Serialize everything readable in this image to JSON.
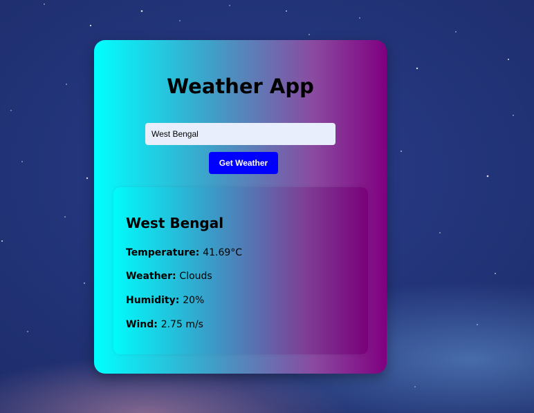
{
  "app": {
    "title": "Weather App"
  },
  "search": {
    "value": "West Bengal",
    "button_label": "Get Weather"
  },
  "result": {
    "city": "West Bengal",
    "temperature_label": "Temperature:",
    "temperature_value": "41.69°C",
    "weather_label": "Weather:",
    "weather_value": "Clouds",
    "humidity_label": "Humidity:",
    "humidity_value": "20%",
    "wind_label": "Wind:",
    "wind_value": "2.75 m/s"
  },
  "colors": {
    "card_gradient_start": "#00ffff",
    "card_gradient_end": "#800080",
    "button": "#0000ff",
    "input_bg": "#e8eefb"
  }
}
